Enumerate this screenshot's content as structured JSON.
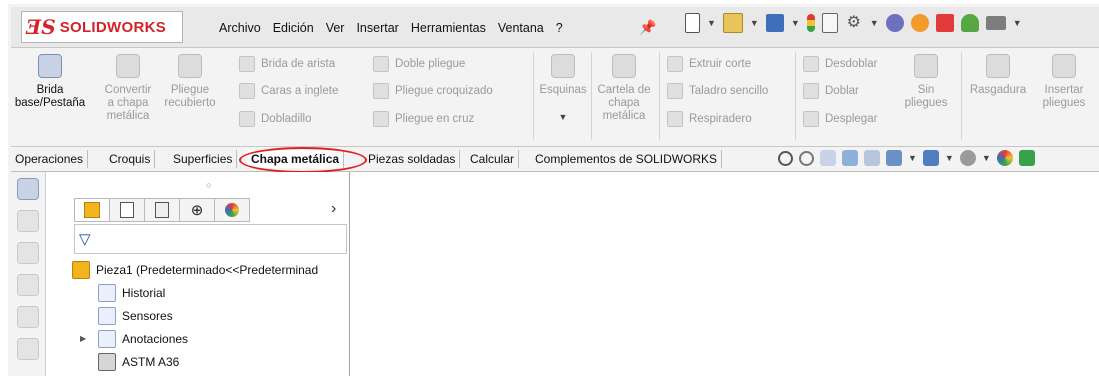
{
  "app": {
    "brand_ds": "ƎS",
    "brand_name": "SOLIDWORKS"
  },
  "menu": [
    "Archivo",
    "Edición",
    "Ver",
    "Insertar",
    "Herramientas",
    "Ventana",
    "?"
  ],
  "quick_access": {
    "icons": [
      "new-file-icon",
      "open-file-icon",
      "save-icon",
      "rebuild-traffic-light-icon",
      "file-properties-icon",
      "options-gear-icon",
      "plugin-icon",
      "record-icon",
      "pdf-icon",
      "user-icon",
      "print-icon"
    ]
  },
  "ribbon": {
    "brida_base": "Brida\nbase/Pestaña",
    "convertir": "Convertir\na chapa\nmetálica",
    "pliegue_recubierto": "Pliegue\nrecubierto",
    "brida_arista": "Brida de arista",
    "caras_inglete": "Caras a inglete",
    "dobladillo": "Dobladillo",
    "doble_pliegue": "Doble pliegue",
    "pliegue_croquizado": "Pliegue croquizado",
    "pliegue_cruz": "Pliegue en cruz",
    "esquinas": "Esquinas",
    "cartela": "Cartela de\nchapa\nmetálica",
    "extruir_corte": "Extruir corte",
    "taladro": "Taladro sencillo",
    "respiradero": "Respiradero",
    "desdoblar": "Desdoblar",
    "doblar": "Doblar",
    "desplegar": "Desplegar",
    "sin_pliegues": "Sin\npliegues",
    "rasgadura": "Rasgadura",
    "insertar_pliegues": "Insertar\npliegues"
  },
  "tabs": [
    "Operaciones",
    "Croquis",
    "Superficies",
    "Chapa metálica",
    "Piezas soldadas",
    "Calcular",
    "Complementos de SOLIDWORKS"
  ],
  "active_tab": "Chapa metálica",
  "feature_manager": {
    "root": "Pieza1  (Predeterminado<<Predeterminad",
    "items": [
      {
        "label": "Historial",
        "icon": "history-icon"
      },
      {
        "label": "Sensores",
        "icon": "sensor-icon"
      },
      {
        "label": "Anotaciones",
        "icon": "annotations-icon"
      },
      {
        "label": "ASTM A36",
        "icon": "material-icon"
      }
    ]
  },
  "colors": {
    "accent_red": "#d2232a",
    "highlight_oval": "#e02020",
    "dash_border": "#1a3d8f"
  }
}
